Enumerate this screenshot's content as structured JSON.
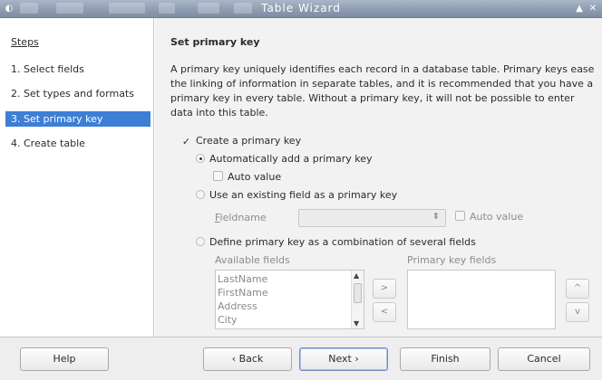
{
  "window": {
    "title": "Table Wizard"
  },
  "steps": {
    "title": "Steps",
    "items": [
      "1. Select fields",
      "2. Set types and formats",
      "3. Set primary key",
      "4. Create table"
    ],
    "active_index": 2
  },
  "main": {
    "heading": "Set primary key",
    "description": "A primary key uniquely identifies each record in a database table. Primary keys ease the linking of information in separate tables, and it is recommended that you have a primary key in every table. Without a primary key, it will not be possible to enter data into this table.",
    "create_pk": {
      "label": "Create a primary key",
      "checked": true
    },
    "auto_add": {
      "label": "Automatically add a primary key",
      "selected": true
    },
    "auto_value": {
      "label": "Auto value",
      "checked": false
    },
    "use_existing": {
      "label": "Use an existing field as a primary key",
      "selected": false
    },
    "fieldname": {
      "label": "Fieldname",
      "value": ""
    },
    "auto_value_2": {
      "label": "Auto value",
      "checked": false
    },
    "define_combination": {
      "label": "Define primary key as a combination of several fields",
      "selected": false
    },
    "available_fields": {
      "label": "Available fields",
      "items": [
        "LastName",
        "FirstName",
        "Address",
        "City"
      ]
    },
    "primary_key_fields": {
      "label": "Primary key fields",
      "items": []
    },
    "move_right": ">",
    "move_left": "<",
    "move_up": "^",
    "move_down": "v"
  },
  "buttons": {
    "help": "Help",
    "back": "‹ Back",
    "next": "Next ›",
    "finish": "Finish",
    "cancel": "Cancel"
  }
}
